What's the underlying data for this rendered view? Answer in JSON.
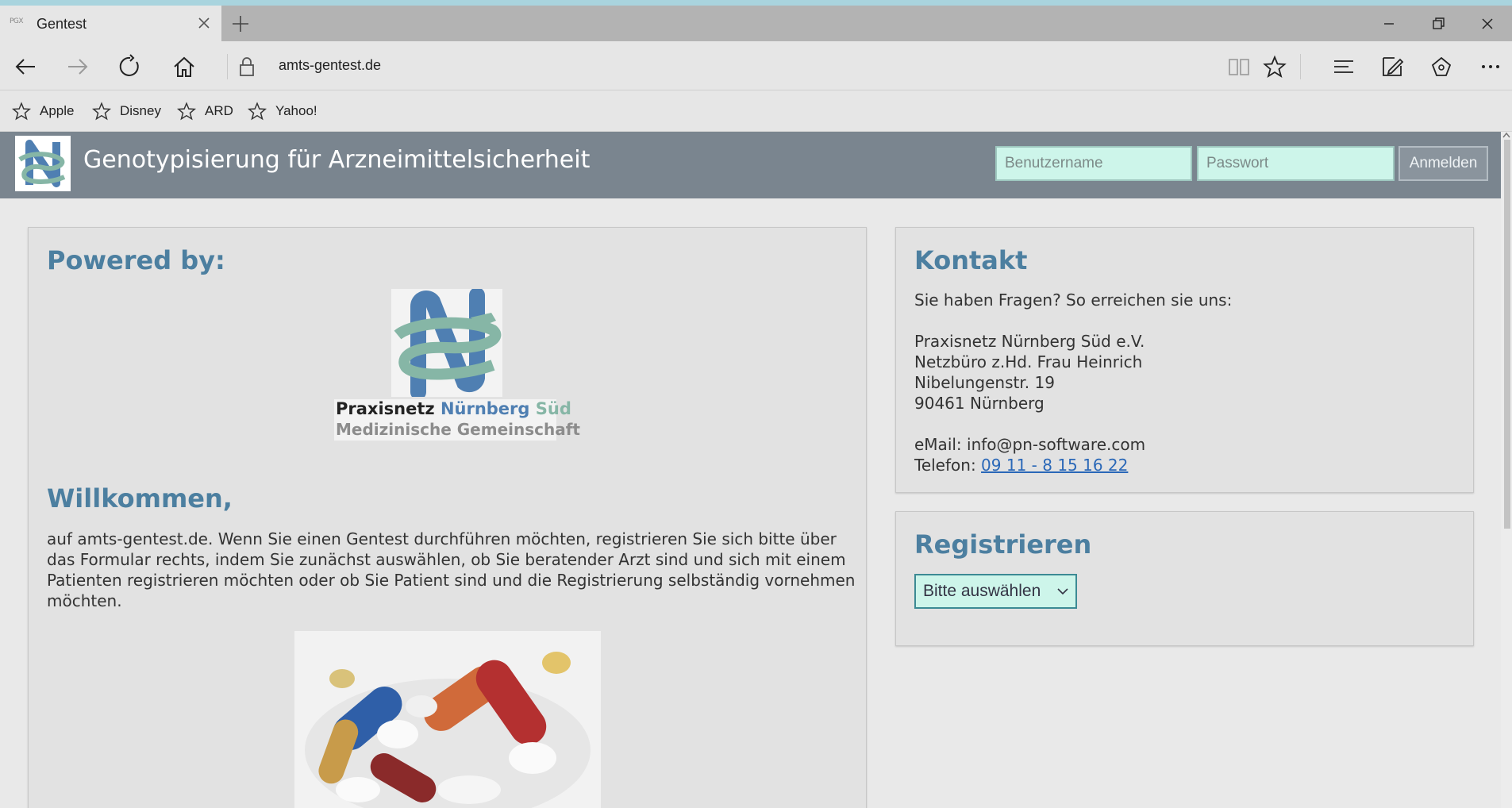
{
  "browser": {
    "tab": {
      "favicon_text": "PGX",
      "title": "Gentest"
    },
    "url": "amts-gentest.de",
    "favorites": [
      {
        "label": "Apple"
      },
      {
        "label": "Disney"
      },
      {
        "label": "ARD"
      },
      {
        "label": "Yahoo!"
      }
    ]
  },
  "site": {
    "title": "Genotypisierung für Arzneimittelsicherheit",
    "login": {
      "username_placeholder": "Benutzername",
      "password_placeholder": "Passwort",
      "submit_label": "Anmelden"
    },
    "powered": {
      "heading": "Powered by:",
      "logo_line1_a": "Praxisnetz",
      "logo_line1_b": "Nürnberg",
      "logo_line1_c": "Süd",
      "logo_line2": "Medizinische Gemeinschaft"
    },
    "welcome": {
      "heading": "Willkommen,",
      "text": "auf amts-gentest.de. Wenn Sie einen Gentest durchführen möchten, registrieren Sie sich bitte über das Formular rechts, indem Sie zunächst auswählen, ob Sie beratender Arzt sind und sich mit einem Patienten registrieren möchten oder ob Sie Patient sind und die Registrierung selbständig vornehmen möchten."
    },
    "contact": {
      "heading": "Kontakt",
      "intro": "Sie haben Fragen? So erreichen sie uns:",
      "address": [
        "Praxisnetz Nürnberg Süd e.V.",
        "Netzbüro z.Hd. Frau Heinrich",
        "Nibelungenstr. 19",
        "90461 Nürnberg"
      ],
      "email_label": "eMail:",
      "email": "info@pn-software.com",
      "phone_label": "Telefon:",
      "phone": "09 11 - 8 15 16 22"
    },
    "register": {
      "heading": "Registrieren",
      "select_value": "Bitte auswählen"
    }
  },
  "colors": {
    "header_bg": "#7a858f",
    "heading": "#4c7fa0",
    "input_bg": "#cdf5ea",
    "logo_blue": "#4f7fb2",
    "logo_green": "#86b6a6"
  }
}
